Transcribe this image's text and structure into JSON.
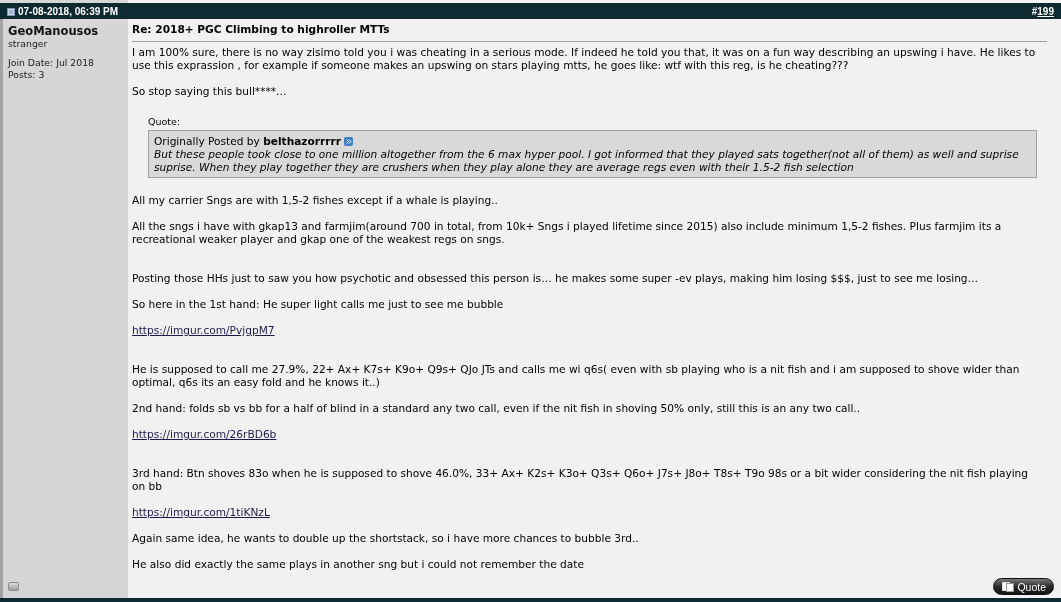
{
  "header": {
    "date": "07-08-2018, 06:39 PM",
    "post_prefix": "#",
    "post_number": "199"
  },
  "author": {
    "name": "GeoManousos",
    "title": "stranger",
    "join_date": "Join Date: Jul 2018",
    "posts": "Posts: 3"
  },
  "post": {
    "title": "Re: 2018+ PGC Climbing to highroller MTTs",
    "sections": [
      [
        {
          "kind": "text",
          "text": "I am 100% sure, there is no way zisimo told you i was cheating in a serious mode. If indeed he told you that, it was on a fun way describing an upswing i have. He likes to use this exprassion , for example if someone makes an upswing on stars playing mtts, he goes like: wtf with this reg, is he cheating???"
        },
        {
          "kind": "text",
          "text": "So stop saying this bull****…"
        },
        {
          "kind": "quote",
          "label": "Quote:",
          "posted_by": "Originally Posted by **belthazorrrrr**",
          "text": "But these people took close to one million altogether from the 6 max hyper pool. I got informed that they played sats together(not all of them) as well and suprise suprise. When they play together they are crushers when they play alone they are average regs even with their 1.5-2 fish selection"
        },
        {
          "kind": "text",
          "text": "All my carrier Sngs are with 1,5-2 fishes except if a whale is playing.."
        },
        {
          "kind": "text",
          "text": "All the sngs i have with gkap13 and farmjim(around 700 in total, from 10k+ Sngs i played lifetime since 2015) also include minimum 1,5-2 fishes. Plus farmjim its a recreational weaker player and gkap one of the weakest regs on sngs."
        }
      ],
      [
        {
          "kind": "text",
          "text": "Posting those HHs just to saw you how psychotic and obsessed this person is… he makes some super -ev plays, making him losing $$$, just to see me losing…"
        },
        {
          "kind": "text",
          "text": "So here in the 1st hand: He super light calls me just to see me bubble"
        },
        {
          "kind": "link",
          "text": "https://imgur.com/PvjgpM7"
        }
      ],
      [
        {
          "kind": "text",
          "text": "He is supposed to call me 27.9%, 22+ Ax+ K7s+ K9o+ Q9s+ QJo JTs and calls me wi q6s( even with sb playing who is a nit fish and i am supposed to shove wider than optimal, q6s its an easy fold and he knows it..)"
        },
        {
          "kind": "text",
          "text": "2nd hand: folds sb vs bb for a half of blind in a standard any two call, even if the nit fish in shoving 50% only, still this is an any two call.."
        },
        {
          "kind": "link",
          "text": "https://imgur.com/26rBD6b"
        }
      ],
      [
        {
          "kind": "text",
          "text": "3rd hand: Btn shoves 83o when he is supposed to shove 46.0%, 33+ Ax+ K2s+ K3o+ Q3s+ Q6o+ J7s+ J8o+ T8s+ T9o 98s or a bit wider considering the nit fish playing on bb"
        },
        {
          "kind": "link",
          "text": "https://imgur.com/1tiKNzL"
        },
        {
          "kind": "text",
          "text": "Again same idea, he wants to double up the shortstack, so i have more chances to bubble 3rd.."
        },
        {
          "kind": "text",
          "text": "He also did exactly the same plays in another sng but i could not remember the date"
        }
      ]
    ],
    "buttons": [
      {
        "label": "Quote"
      }
    ]
  }
}
